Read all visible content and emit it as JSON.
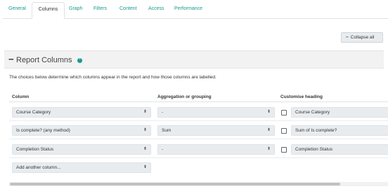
{
  "tabs": [
    {
      "label": "General"
    },
    {
      "label": "Columns"
    },
    {
      "label": "Graph"
    },
    {
      "label": "Filters"
    },
    {
      "label": "Content"
    },
    {
      "label": "Access"
    },
    {
      "label": "Performance"
    }
  ],
  "active_tab": "Columns",
  "collapse_all_label": "Collapse all",
  "section": {
    "title": "Report Columns",
    "description": "The choices below determine which columns appear in the report and how those columns are labelled."
  },
  "table": {
    "headers": {
      "column": "Column",
      "aggregation": "Aggregation or grouping",
      "heading": "Customise heading"
    },
    "rows": [
      {
        "column": "Course Category",
        "aggregation": "-",
        "heading": "Course Category",
        "checked": false
      },
      {
        "column": "Is complete? (any method)",
        "aggregation": "Sum",
        "heading": "Sum of Is complete?",
        "checked": false
      },
      {
        "column": "Completion Status",
        "aggregation": "-",
        "heading": "Completion Status",
        "checked": false
      }
    ],
    "add_column_placeholder": "Add another column..."
  },
  "colors": {
    "link": "#1a9b8a",
    "header_bg": "#f2f2f2",
    "field_bg": "#e9ecef"
  }
}
